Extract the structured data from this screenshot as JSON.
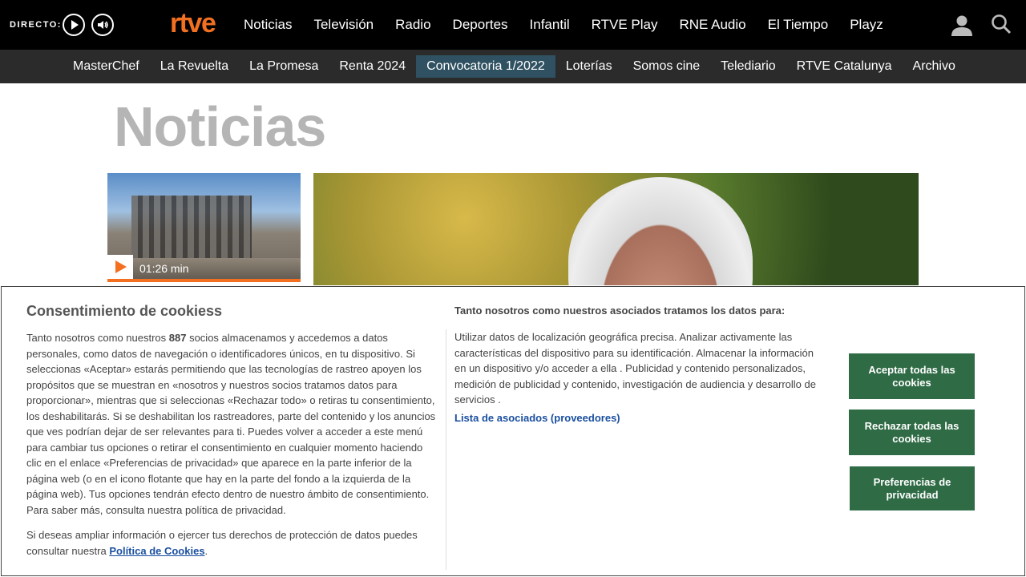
{
  "header": {
    "live_label": "DIRECTO:",
    "logo": "rtve",
    "nav": [
      "Noticias",
      "Televisión",
      "Radio",
      "Deportes",
      "Infantil",
      "RTVE Play",
      "RNE Audio",
      "El Tiempo",
      "Playz"
    ],
    "logo_color": "#f37021"
  },
  "subnav": {
    "items": [
      "MasterChef",
      "La Revuelta",
      "La Promesa",
      "Renta 2024",
      "Convocatoria 1/2022",
      "Loterías",
      "Somos cine",
      "Telediario",
      "RTVE Catalunya",
      "Archivo"
    ],
    "active": "Convocatoria 1/2022"
  },
  "page": {
    "title": "Noticias",
    "video_duration": "01:26 min"
  },
  "cookie_banner": {
    "title": "Consentimiento de cookiess",
    "body_before": "Tanto nosotros como nuestros ",
    "vendor_count": "887",
    "body_after": " socios almacenamos y accedemos a datos personales, como datos de navegación o identificadores únicos, en tu dispositivo. Si seleccionas «Aceptar» estarás permitiendo que las tecnologías de rastreo apoyen los propósitos que se muestran en «nosotros y nuestros socios tratamos datos para proporcionar», mientras que si seleccionas «Rechazar todo» o retiras tu consentimiento, los deshabilitarás. Si se deshabilitan los rastreadores, parte del contenido y los anuncios que ves podrían dejar de ser relevantes para ti. Puedes volver a acceder a este menú para cambiar tus opciones o retirar el consentimiento en cualquier momento haciendo clic en el enlace «Preferencias de privacidad» que aparece en la parte inferior de la página web (o en el icono flotante que hay en la parte del fondo a la izquierda de la página web). Tus opciones tendrán efecto dentro de nuestro ámbito de consentimiento. Para saber más, consulta nuestra política de privacidad.",
    "rights_text": "Si deseas ampliar información o ejercer tus derechos de protección de datos puedes consultar nuestra ",
    "policy_link": "Política de Cookies",
    "policy_end": ".",
    "purposes_title": "Tanto nosotros como nuestros asociados tratamos los datos para:",
    "purposes_text": "Utilizar datos de localización geográfica precisa. Analizar activamente las características del dispositivo para su identificación. Almacenar la información en un dispositivo y/o acceder a ella . Publicidad y contenido personalizados, medición de publicidad y contenido, investigación de audiencia y desarrollo de servicios .",
    "vendors_link": "Lista de asociados (proveedores)",
    "accept_label": "Aceptar todas las cookies",
    "reject_label": "Rechazar todas las cookies",
    "prefs_label": "Preferencias de privacidad",
    "button_color": "#2f6b45"
  }
}
